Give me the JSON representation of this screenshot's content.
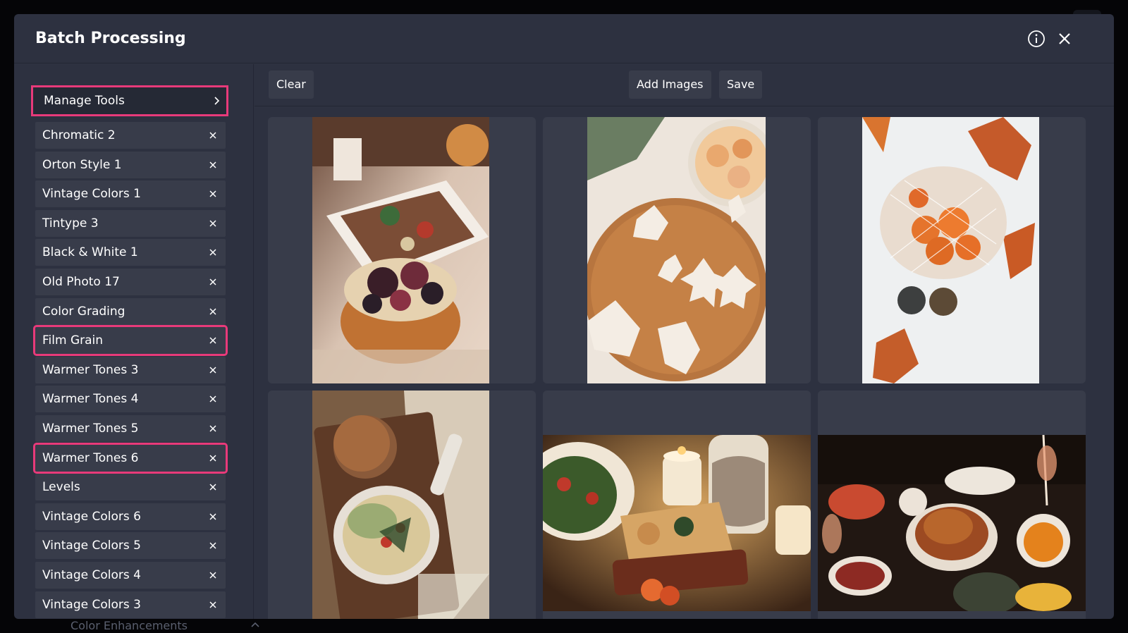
{
  "modal": {
    "title": "Batch Processing",
    "info_icon": "info-icon",
    "close_icon": "close-icon"
  },
  "sidebar": {
    "manage_label": "Manage Tools",
    "tools": [
      {
        "label": "Chromatic 2",
        "highlighted": false
      },
      {
        "label": "Orton Style 1",
        "highlighted": false
      },
      {
        "label": "Vintage Colors 1",
        "highlighted": false
      },
      {
        "label": "Tintype 3",
        "highlighted": false
      },
      {
        "label": "Black & White 1",
        "highlighted": false
      },
      {
        "label": "Old Photo 17",
        "highlighted": false
      },
      {
        "label": "Color Grading",
        "highlighted": false
      },
      {
        "label": "Film Grain",
        "highlighted": true
      },
      {
        "label": "Warmer Tones 3",
        "highlighted": false
      },
      {
        "label": "Warmer Tones 4",
        "highlighted": false
      },
      {
        "label": "Warmer Tones 5",
        "highlighted": false
      },
      {
        "label": "Warmer Tones 6",
        "highlighted": true
      },
      {
        "label": "Levels",
        "highlighted": false
      },
      {
        "label": "Vintage Colors 6",
        "highlighted": false
      },
      {
        "label": "Vintage Colors 5",
        "highlighted": false
      },
      {
        "label": "Vintage Colors 4",
        "highlighted": false
      },
      {
        "label": "Vintage Colors 3",
        "highlighted": false
      }
    ]
  },
  "toolbar": {
    "clear_label": "Clear",
    "add_images_label": "Add Images",
    "save_label": "Save"
  },
  "images": [
    {
      "name": "fig-dessert-table-photo",
      "orientation": "portrait"
    },
    {
      "name": "gingerbread-cookies-photo",
      "orientation": "portrait"
    },
    {
      "name": "tangerines-in-snow-photo",
      "orientation": "portrait"
    },
    {
      "name": "soup-bowl-photo",
      "orientation": "portrait"
    },
    {
      "name": "candlelit-dinner-photo",
      "orientation": "landscape"
    },
    {
      "name": "roast-chicken-feast-photo",
      "orientation": "landscape"
    }
  ],
  "background": {
    "partial_label": "Color Enhancements"
  },
  "colors": {
    "highlight": "#e83a7a",
    "modal_bg": "#2d3140",
    "item_bg": "#383c4a"
  }
}
